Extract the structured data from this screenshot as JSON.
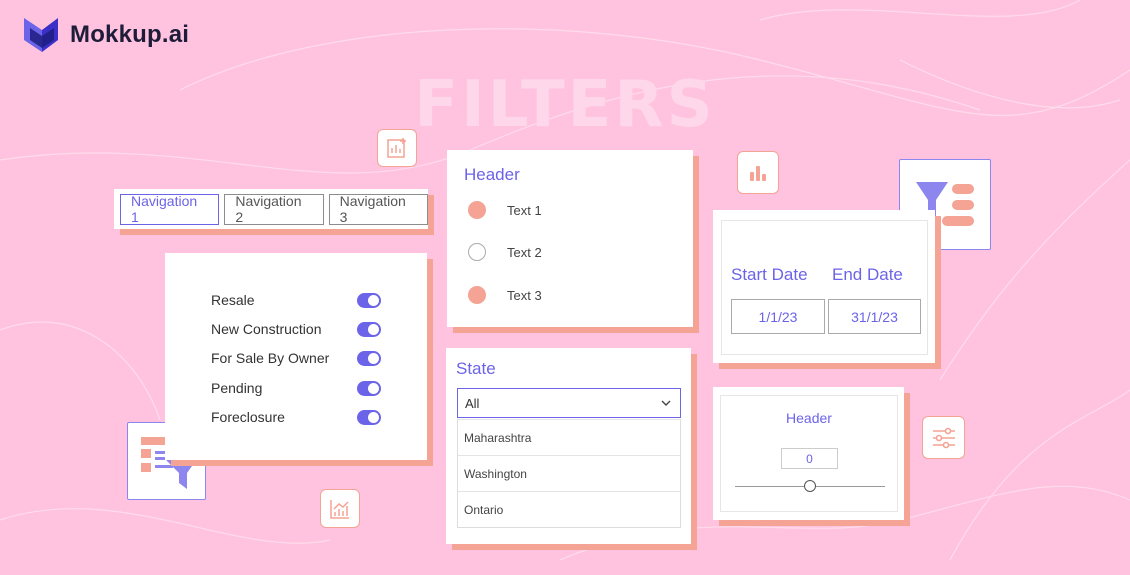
{
  "brand": {
    "name": "Mokkup.ai"
  },
  "hero": {
    "title": "FILTERS"
  },
  "navigation": {
    "items": [
      {
        "label": "Navigation 1",
        "active": true
      },
      {
        "label": "Navigation 2",
        "active": false
      },
      {
        "label": "Navigation 3",
        "active": false
      }
    ]
  },
  "toggles": {
    "items": [
      {
        "label": "Resale",
        "on": true
      },
      {
        "label": "New Construction",
        "on": true
      },
      {
        "label": "For Sale By Owner",
        "on": true
      },
      {
        "label": "Pending",
        "on": true
      },
      {
        "label": "Foreclosure",
        "on": true
      }
    ]
  },
  "radio_card": {
    "header": "Header",
    "options": [
      {
        "label": "Text 1",
        "selected": true
      },
      {
        "label": "Text 2",
        "selected": false
      },
      {
        "label": "Text 3",
        "selected": true
      }
    ]
  },
  "state_dropdown": {
    "label": "State",
    "selected": "All",
    "options": [
      "Maharashtra",
      "Washington",
      "Ontario"
    ]
  },
  "date_range": {
    "start_label": "Start Date",
    "end_label": "End Date",
    "start_value": "1/1/23",
    "end_value": "31/1/23"
  },
  "slider": {
    "header": "Header",
    "value": "0"
  },
  "colors": {
    "background": "#ffc3df",
    "accent": "#6b63e8",
    "coral": "#f4a394",
    "title_tint": "#ffd7ea"
  },
  "icons": [
    "logo-mark-icon",
    "bar-chart-add-icon",
    "bar-chart-icon",
    "filter-list-icon",
    "table-filter-icon",
    "line-chart-icon",
    "sliders-icon",
    "chevron-down-icon"
  ]
}
